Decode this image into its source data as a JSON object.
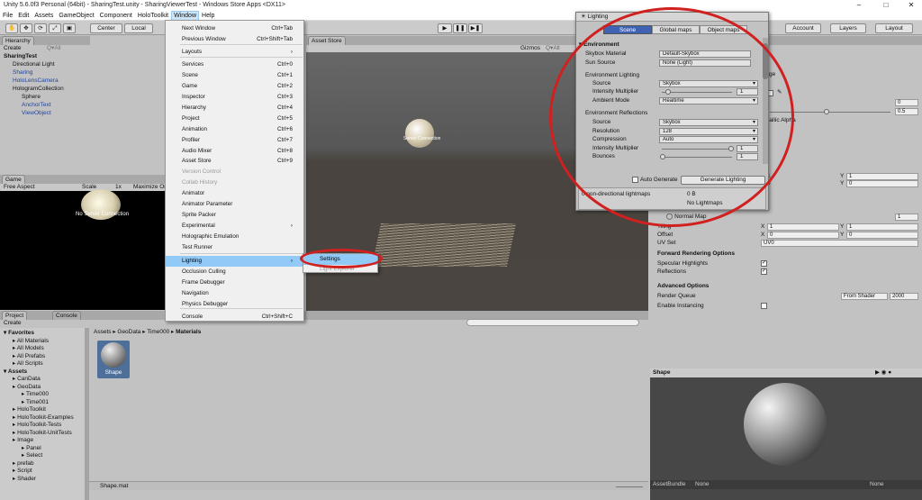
{
  "window": {
    "title": "Unity 5.6.0f3 Personal (64bit) - SharingTest.unity - SharingViewerTest - Windows Store Apps <DX11>",
    "minimize": "–",
    "maximize": "□",
    "close": "✕"
  },
  "menubar": [
    "File",
    "Edit",
    "Assets",
    "GameObject",
    "Component",
    "HoloToolkit",
    "Window",
    "Help"
  ],
  "toolbar": {
    "center": "Center",
    "local": "Local",
    "account": "Account",
    "layers": "Layers",
    "layout": "Layout"
  },
  "hierarchy": {
    "tab": "Hierarchy",
    "create": "Create",
    "search": "Q▾All",
    "scene": "SharingTest",
    "items": [
      "Directional Light",
      "Sharing",
      "HoloLensCamera",
      "HologramCollection",
      "Sphere",
      "AnchorText",
      "ViewObject"
    ]
  },
  "scene_tab": "Asset Store",
  "scene_gizmos": "Gizmos",
  "scene_search": "Q▾All",
  "scene_label": "Server Connection",
  "game": {
    "tab": "Game",
    "aspect": "Free Aspect",
    "scale": "Scale",
    "scale_val": "1x",
    "maximize": "Maximize On",
    "label": "No Server Connection"
  },
  "window_menu": {
    "items": [
      {
        "label": "Next Window",
        "shortcut": "Ctrl+Tab"
      },
      {
        "label": "Previous Window",
        "shortcut": "Ctrl+Shift+Tab"
      },
      {
        "label": "Layouts",
        "shortcut": "›"
      },
      {
        "label": "Services",
        "shortcut": "Ctrl+0"
      },
      {
        "label": "Scene",
        "shortcut": "Ctrl+1"
      },
      {
        "label": "Game",
        "shortcut": "Ctrl+2"
      },
      {
        "label": "Inspector",
        "shortcut": "Ctrl+3"
      },
      {
        "label": "Hierarchy",
        "shortcut": "Ctrl+4"
      },
      {
        "label": "Project",
        "shortcut": "Ctrl+5"
      },
      {
        "label": "Animation",
        "shortcut": "Ctrl+6"
      },
      {
        "label": "Profiler",
        "shortcut": "Ctrl+7"
      },
      {
        "label": "Audio Mixer",
        "shortcut": "Ctrl+8"
      },
      {
        "label": "Asset Store",
        "shortcut": "Ctrl+9"
      },
      {
        "label": "Version Control",
        "shortcut": ""
      },
      {
        "label": "Collab History",
        "shortcut": ""
      },
      {
        "label": "Animator",
        "shortcut": ""
      },
      {
        "label": "Animator Parameter",
        "shortcut": ""
      },
      {
        "label": "Sprite Packer",
        "shortcut": ""
      },
      {
        "label": "Experimental",
        "shortcut": "›"
      },
      {
        "label": "Holographic Emulation",
        "shortcut": ""
      },
      {
        "label": "Test Runner",
        "shortcut": ""
      },
      {
        "label": "Lighting",
        "shortcut": "›"
      },
      {
        "label": "Occlusion Culling",
        "shortcut": ""
      },
      {
        "label": "Frame Debugger",
        "shortcut": ""
      },
      {
        "label": "Navigation",
        "shortcut": ""
      },
      {
        "label": "Physics Debugger",
        "shortcut": ""
      },
      {
        "label": "Console",
        "shortcut": "Ctrl+Shift+C"
      }
    ]
  },
  "lighting_submenu": {
    "settings": "Settings",
    "explorer": "Light Explorer"
  },
  "lighting": {
    "title": "Lighting",
    "tabs": [
      "Scene",
      "Global maps",
      "Object maps"
    ],
    "environment": "Environment",
    "skybox_label": "Skybox Material",
    "skybox_val": "Default-Skybox",
    "sun_label": "Sun Source",
    "sun_val": "None (Light)",
    "env_lighting": "Environment Lighting",
    "source_label": "Source",
    "source_val": "Skybox",
    "intensity_label": "Intensity Multiplier",
    "intensity_val": "1",
    "ambient_label": "Ambient Mode",
    "ambient_val": "Realtime",
    "env_refl": "Environment Reflections",
    "rsource_label": "Source",
    "rsource_val": "Skybox",
    "res_label": "Resolution",
    "res_val": "128",
    "comp_label": "Compression",
    "comp_val": "Auto",
    "rint_label": "Intensity Multiplier",
    "rint_val": "1",
    "bounce_label": "Bounces",
    "bounce_val": "1",
    "auto_generate": "Auto Generate",
    "generate": "Generate Lighting",
    "lightmaps_info": "0 non-directional lightmaps",
    "lightmaps_size": "0 B",
    "no_lightmaps": "No Lightmaps"
  },
  "inspector": {
    "x_label": "X",
    "y_label": "Y",
    "v1": "1",
    "v0": "0",
    "v05": "0.5",
    "shader": "lage",
    "metallic": "etallic Alpha",
    "normal_map": "Normal Map",
    "normal_val": "1",
    "tiling": "Tiling",
    "offset": "Offset",
    "uvset": "UV Set",
    "uvset_val": "UV0",
    "fro": "Forward Rendering Options",
    "spec": "Specular Highlights",
    "refl": "Reflections",
    "adv": "Advanced Options",
    "rq": "Render Queue",
    "rq_mode": "From Shader",
    "rq_val": "2000",
    "instancing": "Enable Instancing"
  },
  "preview": {
    "title": "Shape",
    "assetbundle": "AssetBundle",
    "none1": "None",
    "none2": "None"
  },
  "project": {
    "tab": "Project",
    "console_tab": "Console",
    "create": "Create",
    "breadcrumb": [
      "Assets",
      "GeoData",
      "Time000",
      "Materials"
    ],
    "asset": "Shape",
    "footer": "Shape.mat",
    "tree": [
      {
        "label": "Favorites",
        "level": 0,
        "bold": true
      },
      {
        "label": "All Materials",
        "level": 1
      },
      {
        "label": "All Models",
        "level": 1
      },
      {
        "label": "All Prefabs",
        "level": 1
      },
      {
        "label": "All Scripts",
        "level": 1
      },
      {
        "label": "Assets",
        "level": 0,
        "bold": true
      },
      {
        "label": "CanData",
        "level": 1
      },
      {
        "label": "GeoData",
        "level": 1
      },
      {
        "label": "Time000",
        "level": 2
      },
      {
        "label": "Time001",
        "level": 2
      },
      {
        "label": "HoloToolkit",
        "level": 1
      },
      {
        "label": "HoloToolkit-Examples",
        "level": 1
      },
      {
        "label": "HoloToolkit-Tests",
        "level": 1
      },
      {
        "label": "HoloToolkit-UnitTests",
        "level": 1
      },
      {
        "label": "Image",
        "level": 1
      },
      {
        "label": "Panel",
        "level": 2
      },
      {
        "label": "Select",
        "level": 2
      },
      {
        "label": "prefab",
        "level": 1
      },
      {
        "label": "Script",
        "level": 1
      },
      {
        "label": "Shader",
        "level": 1
      }
    ]
  }
}
